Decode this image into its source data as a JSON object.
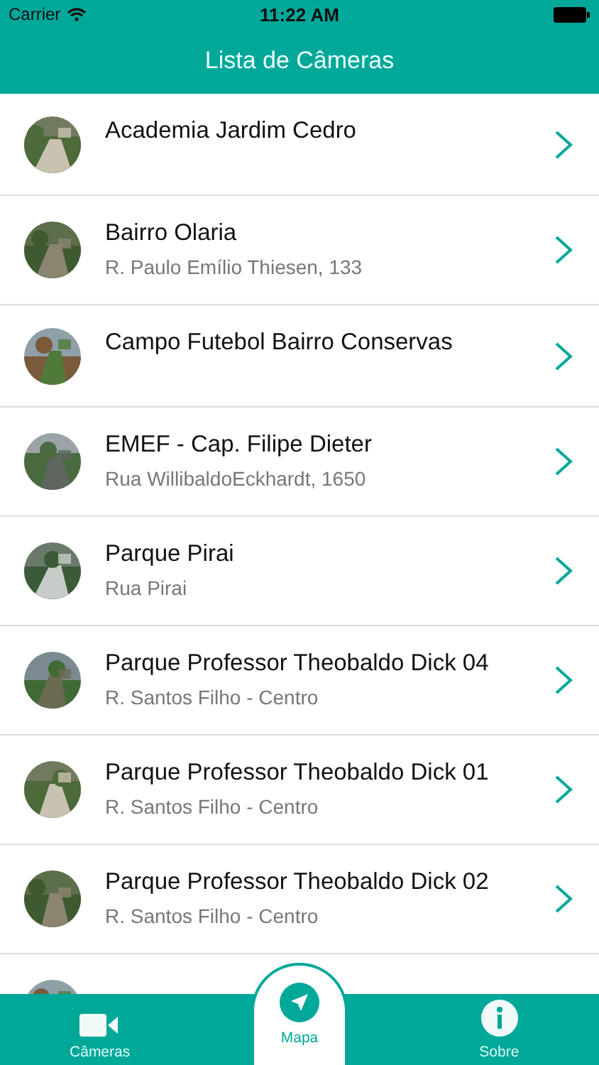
{
  "status_bar": {
    "carrier": "Carrier",
    "time": "11:22 AM"
  },
  "nav_bar": {
    "title": "Lista de Câmeras"
  },
  "cameras": [
    {
      "title": "Academia Jardim Cedro"
    },
    {
      "title": "Bairro Olaria",
      "subtitle": "R. Paulo Emílio Thiesen, 133"
    },
    {
      "title": "Campo Futebol Bairro Conservas"
    },
    {
      "title": "EMEF - Cap. Filipe Dieter",
      "subtitle": "Rua WillibaldoEckhardt, 1650"
    },
    {
      "title": "Parque Pirai",
      "subtitle": "Rua Pirai"
    },
    {
      "title": "Parque Professor Theobaldo Dick 04",
      "subtitle": "R. Santos Filho - Centro"
    },
    {
      "title": "Parque Professor Theobaldo Dick 01",
      "subtitle": "R. Santos Filho - Centro"
    },
    {
      "title": "Parque Professor Theobaldo Dick 02",
      "subtitle": "R. Santos Filho - Centro"
    },
    {
      "kind": "picture"
    }
  ],
  "tab_bar": [
    {
      "kind": "camera",
      "label": "Câmeras",
      "selected": false
    },
    {
      "kind": "map",
      "label": "Mapa",
      "selected": true
    },
    {
      "kind": "info",
      "label": "Sobre",
      "selected": false
    }
  ]
}
